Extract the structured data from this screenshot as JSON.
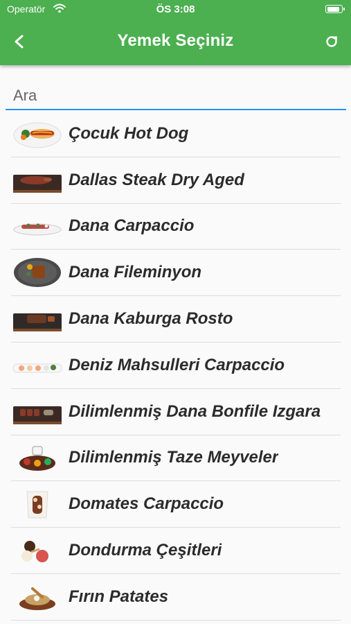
{
  "status_bar": {
    "carrier": "Operatör",
    "time": "ÖS 3:08",
    "battery_level": 0.9
  },
  "app_bar": {
    "title": "Yemek Seçiniz",
    "back_icon": "chevron-left-icon",
    "refresh_icon": "refresh-icon"
  },
  "search": {
    "placeholder": "Ara",
    "value": ""
  },
  "foods": [
    {
      "name": "Çocuk Hot Dog",
      "image": "hot-dog-plate"
    },
    {
      "name": "Dallas Steak Dry Aged",
      "image": "steak-on-slate"
    },
    {
      "name": "Dana Carpaccio",
      "image": "carpaccio-plate"
    },
    {
      "name": "Dana Fileminyon",
      "image": "fillet-round-plate"
    },
    {
      "name": "Dana Kaburga Rosto",
      "image": "ribs-on-slate"
    },
    {
      "name": "Deniz Mahsulleri Carpaccio",
      "image": "seafood-carpaccio-plate"
    },
    {
      "name": "Dilimlenmiş Dana Bonfile Izgara",
      "image": "sliced-beef-on-slate"
    },
    {
      "name": "Dilimlenmiş Taze Meyveler",
      "image": "fruit-platter"
    },
    {
      "name": "Domates Carpaccio",
      "image": "tomato-carpaccio-plate"
    },
    {
      "name": "Dondurma Çeşitleri",
      "image": "ice-cream-scoops"
    },
    {
      "name": "Fırın Patates",
      "image": "baked-potato-board"
    }
  ],
  "colors": {
    "app_bar": "#4caf50",
    "search_underline": "#2196f3",
    "divider": "#dcdcdc"
  }
}
